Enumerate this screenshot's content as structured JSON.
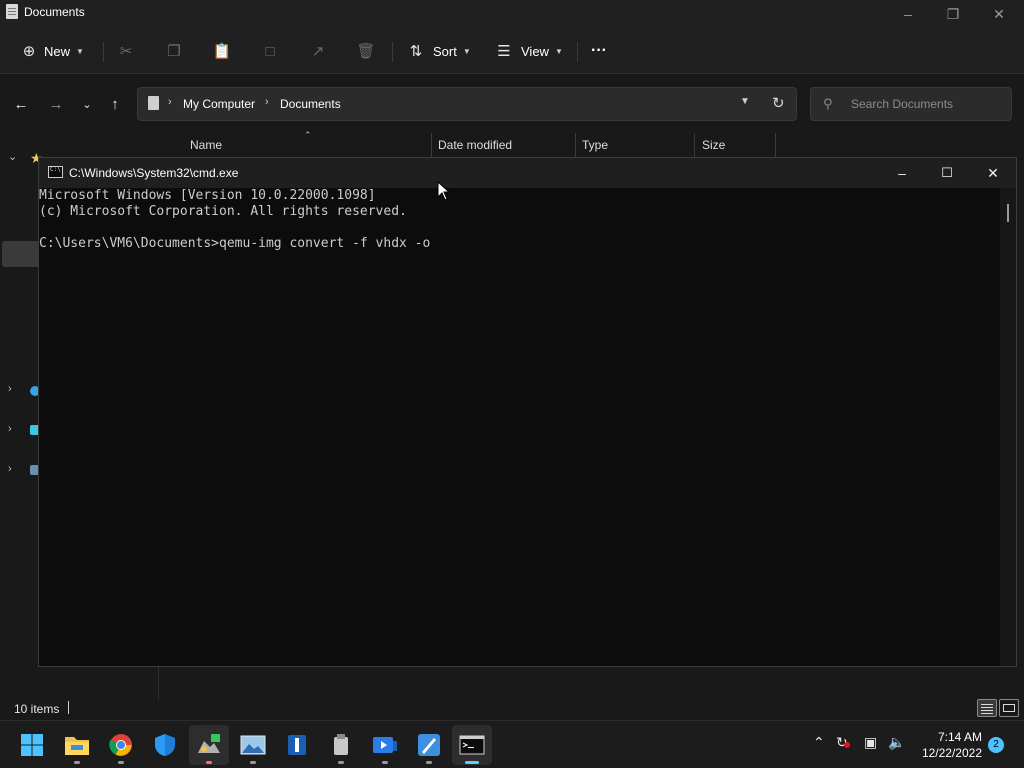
{
  "explorer": {
    "window_title": "Documents",
    "toolbar": {
      "new_label": "New",
      "sort_label": "Sort",
      "view_label": "View",
      "more_label": "···"
    },
    "address": {
      "crumbs": [
        "My Computer",
        "Documents"
      ]
    },
    "search": {
      "placeholder": "Search Documents"
    },
    "columns": [
      "Name",
      "Date modified",
      "Type",
      "Size"
    ],
    "status": {
      "item_count": "10 items"
    }
  },
  "cmd": {
    "window_title": "C:\\Windows\\System32\\cmd.exe",
    "lines": [
      "Microsoft Windows [Version 10.0.22000.1098]",
      "(c) Microsoft Corporation. All rights reserved.",
      "",
      "C:\\Users\\VM6\\Documents>qemu-img convert -f vhdx -o"
    ]
  },
  "taskbar": {
    "apps": [
      "start",
      "file-explorer",
      "chrome",
      "windows-security",
      "app-5",
      "photos",
      "app-7",
      "app-8",
      "app-9",
      "app-10",
      "command-prompt"
    ],
    "clock_time": "7:14 AM",
    "clock_date": "12/22/2022",
    "notification_count": "2"
  },
  "colors": {
    "accent": "#60cdff",
    "console_text": "#cccccc",
    "console_bg": "#0c0c0c"
  }
}
